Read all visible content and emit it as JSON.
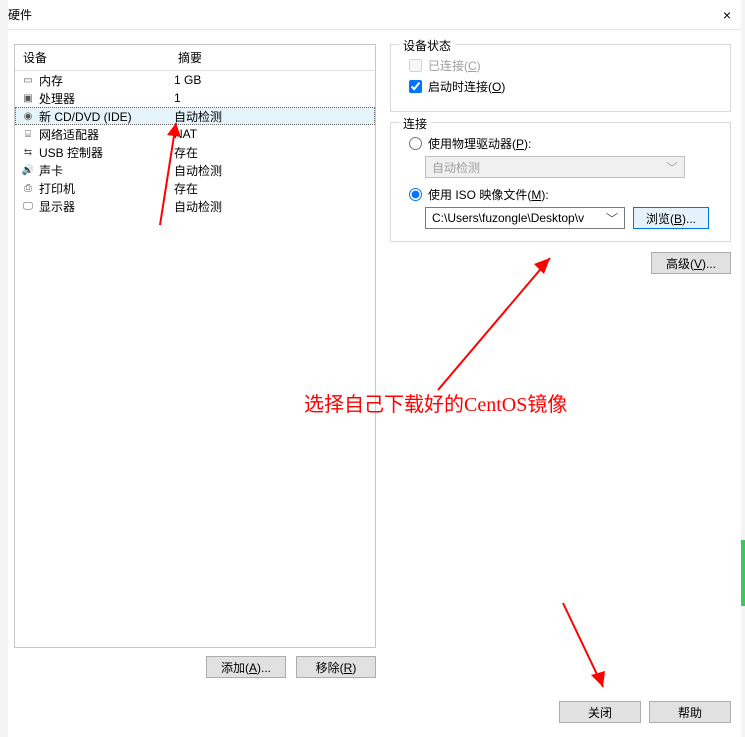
{
  "window": {
    "title": "硬件",
    "close_glyph": "×"
  },
  "device_table": {
    "headers": {
      "device": "设备",
      "summary": "摘要"
    },
    "rows": [
      {
        "icon": "memory-icon",
        "name": "内存",
        "summary": "1 GB",
        "selected": false
      },
      {
        "icon": "cpu-icon",
        "name": "处理器",
        "summary": "1",
        "selected": false
      },
      {
        "icon": "disc-icon",
        "name": "新 CD/DVD (IDE)",
        "summary": "自动检测",
        "selected": true
      },
      {
        "icon": "network-icon",
        "name": "网络适配器",
        "summary": "NAT",
        "selected": false
      },
      {
        "icon": "usb-icon",
        "name": "USB 控制器",
        "summary": "存在",
        "selected": false
      },
      {
        "icon": "sound-icon",
        "name": "声卡",
        "summary": "自动检测",
        "selected": false
      },
      {
        "icon": "printer-icon",
        "name": "打印机",
        "summary": "存在",
        "selected": false
      },
      {
        "icon": "display-icon",
        "name": "显示器",
        "summary": "自动检测",
        "selected": false
      }
    ]
  },
  "left_buttons": {
    "add": "添加(A)...",
    "remove": "移除(R)"
  },
  "device_status": {
    "legend": "设备状态",
    "connected": {
      "label": "已连接(C)",
      "checked": false,
      "disabled": true
    },
    "connect_at_power_on": {
      "label": "启动时连接(O)",
      "checked": true
    }
  },
  "connection": {
    "legend": "连接",
    "physical_drive": {
      "label": "使用物理驱动器(P):",
      "selected": false
    },
    "physical_drive_value": "自动检测",
    "iso_file": {
      "label": "使用 ISO 映像文件(M):",
      "selected": true
    },
    "iso_path": "C:\\Users\\fuzongle\\Desktop\\v",
    "browse": "浏览(B)..."
  },
  "advanced_button": "高级(V)...",
  "footer": {
    "close": "关闭",
    "help": "帮助"
  },
  "annotation": {
    "text": "选择自己下载好的CentOS镜像"
  },
  "icon_glyphs": {
    "memory-icon": "▭",
    "cpu-icon": "▣",
    "disc-icon": "◉",
    "network-icon": "⌸",
    "usb-icon": "⇆",
    "sound-icon": "🔊",
    "printer-icon": "⎙",
    "display-icon": "🖵",
    "chevron-down": "﹀"
  }
}
